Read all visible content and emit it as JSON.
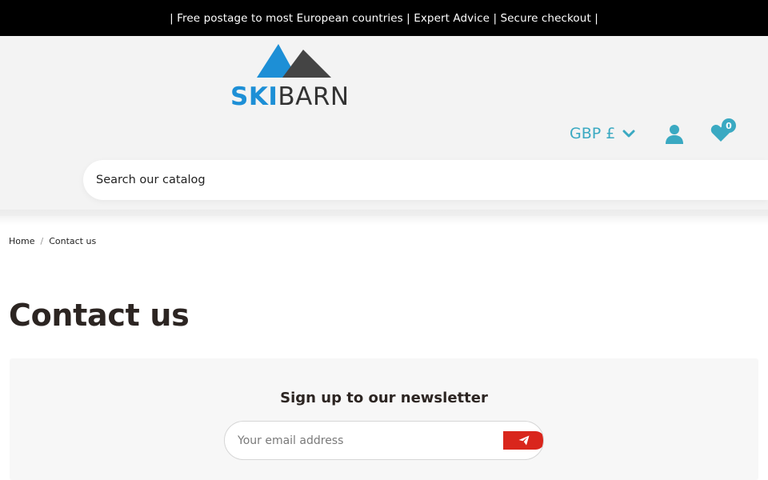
{
  "topbar": {
    "text": "| Free postage to most European countries | Expert Advice | Secure checkout |"
  },
  "brand": {
    "name_part1": "SKI",
    "name_part2": "BARN",
    "colors": {
      "accent": "#1d8fd6",
      "dark": "#333333"
    }
  },
  "header": {
    "currency": {
      "label": "GBP £",
      "icon": "chevron-down-icon"
    },
    "account": {
      "icon": "user-icon"
    },
    "wishlist": {
      "icon": "heart-icon",
      "count": "0"
    },
    "search": {
      "placeholder": "Search our catalog"
    },
    "colors": {
      "link": "#3aa9c2",
      "background": "#f3f3f3"
    }
  },
  "breadcrumb": {
    "items": [
      {
        "label": "Home"
      },
      {
        "label": "Contact us"
      }
    ]
  },
  "page": {
    "title": "Contact us"
  },
  "newsletter": {
    "title": "Sign up to our newsletter",
    "email_placeholder": "Your email address",
    "submit_icon": "send-icon",
    "colors": {
      "button": "#d9261c"
    }
  }
}
